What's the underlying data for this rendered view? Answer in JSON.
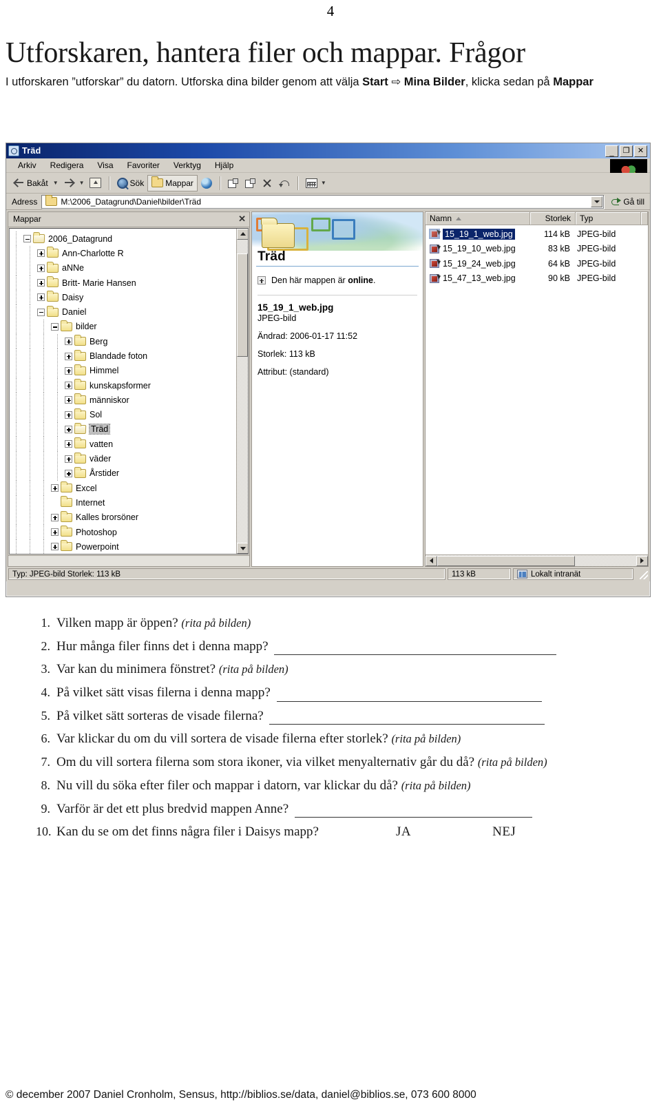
{
  "page": {
    "page_number": "4",
    "title": "Utforskaren, hantera filer och mappar. Frågor",
    "intro_part1": "I utforskaren ”utforskar” du datorn. Utforska dina bilder genom att välja ",
    "intro_bold1": "Start",
    "intro_arrow": " ⇨ ",
    "intro_bold2": "Mina Bilder",
    "intro_part2": ", klicka sedan på ",
    "intro_bold3": "Mappar",
    "footer": "© december 2007 Daniel Cronholm, Sensus, http://biblios.se/data, daniel@biblios.se, 073 600 8000"
  },
  "explorer": {
    "title": "Träd",
    "window_buttons": {
      "minimize": "_",
      "maximize": "❐",
      "close": "✕"
    },
    "menu": [
      "Arkiv",
      "Redigera",
      "Visa",
      "Favoriter",
      "Verktyg",
      "Hjälp"
    ],
    "toolbar": {
      "back": "Bakåt",
      "search": "Sök",
      "folders": "Mappar"
    },
    "address": {
      "label": "Adress",
      "value": "M:\\2006_Datagrund\\Daniel\\bilder\\Träd",
      "go": "Gå till"
    },
    "folders_pane": {
      "header": "Mappar",
      "close": "✕",
      "tree": [
        {
          "label": "2006_Datagrund",
          "depth": 2,
          "toggle": "minus",
          "open": true,
          "selected": false
        },
        {
          "label": "Ann-Charlotte R",
          "depth": 3,
          "toggle": "plus",
          "open": false,
          "selected": false
        },
        {
          "label": "aNNe",
          "depth": 3,
          "toggle": "plus",
          "open": false,
          "selected": false
        },
        {
          "label": "Britt- Marie Hansen",
          "depth": 3,
          "toggle": "plus",
          "open": false,
          "selected": false
        },
        {
          "label": "Daisy",
          "depth": 3,
          "toggle": "plus",
          "open": false,
          "selected": false
        },
        {
          "label": "Daniel",
          "depth": 3,
          "toggle": "minus",
          "open": false,
          "selected": false
        },
        {
          "label": "bilder",
          "depth": 4,
          "toggle": "minus",
          "open": false,
          "selected": false
        },
        {
          "label": "Berg",
          "depth": 5,
          "toggle": "plus",
          "open": false,
          "selected": false
        },
        {
          "label": "Blandade foton",
          "depth": 5,
          "toggle": "plus",
          "open": false,
          "selected": false
        },
        {
          "label": "Himmel",
          "depth": 5,
          "toggle": "plus",
          "open": false,
          "selected": false
        },
        {
          "label": "kunskapsformer",
          "depth": 5,
          "toggle": "plus",
          "open": false,
          "selected": false
        },
        {
          "label": "människor",
          "depth": 5,
          "toggle": "plus",
          "open": false,
          "selected": false
        },
        {
          "label": "Sol",
          "depth": 5,
          "toggle": "plus",
          "open": false,
          "selected": false
        },
        {
          "label": "Träd",
          "depth": 5,
          "toggle": "plus",
          "open": true,
          "selected": true
        },
        {
          "label": "vatten",
          "depth": 5,
          "toggle": "plus",
          "open": false,
          "selected": false
        },
        {
          "label": "väder",
          "depth": 5,
          "toggle": "plus",
          "open": false,
          "selected": false
        },
        {
          "label": "Årstider",
          "depth": 5,
          "toggle": "plus",
          "open": false,
          "selected": false
        },
        {
          "label": "Excel",
          "depth": 4,
          "toggle": "plus",
          "open": false,
          "selected": false
        },
        {
          "label": "Internet",
          "depth": 4,
          "toggle": "none",
          "open": false,
          "selected": false
        },
        {
          "label": "Kalles brorsöner",
          "depth": 4,
          "toggle": "plus",
          "open": false,
          "selected": false
        },
        {
          "label": "Photoshop",
          "depth": 4,
          "toggle": "plus",
          "open": false,
          "selected": false
        },
        {
          "label": "Powerpoint",
          "depth": 4,
          "toggle": "plus",
          "open": false,
          "selected": false
        }
      ]
    },
    "details_pane": {
      "banner_title": "Träd",
      "online_text_prefix": "Den här mappen är ",
      "online_text_bold": "online",
      "online_text_suffix": ".",
      "file_name": "15_19_1_web.jpg",
      "file_type": "JPEG-bild",
      "modified": "Ändrad: 2006-01-17 11:52",
      "size": "Storlek: 113 kB",
      "attributes": "Attribut: (standard)"
    },
    "file_list": {
      "columns": [
        "Namn",
        "Storlek",
        "Typ"
      ],
      "sort_column": "Namn",
      "sort_direction": "asc",
      "rows": [
        {
          "name": "15_19_1_web.jpg",
          "size": "114 kB",
          "type": "JPEG-bild",
          "selected": true
        },
        {
          "name": "15_19_10_web.jpg",
          "size": "83 kB",
          "type": "JPEG-bild",
          "selected": false
        },
        {
          "name": "15_19_24_web.jpg",
          "size": "64 kB",
          "type": "JPEG-bild",
          "selected": false
        },
        {
          "name": "15_47_13_web.jpg",
          "size": "90 kB",
          "type": "JPEG-bild",
          "selected": false
        }
      ]
    },
    "status_bar": {
      "info": "Typ: JPEG-bild Storlek: 113 kB",
      "size": "113 kB",
      "zone": "Lokalt intranät"
    }
  },
  "questions": [
    {
      "num": "1.",
      "text": "Vilken mapp är öppen? ",
      "hint": "(rita på bilden)",
      "blank": 0
    },
    {
      "num": "2.",
      "text": "Hur många filer finns det i denna mapp? ",
      "hint": "",
      "blank": 410
    },
    {
      "num": "3.",
      "text": "Var kan du minimera fönstret? ",
      "hint": "(rita på bilden)",
      "blank": 0
    },
    {
      "num": "4.",
      "text": "På vilket sätt visas filerna i denna mapp? ",
      "hint": "",
      "blank": 385
    },
    {
      "num": "5.",
      "text": "På vilket sätt sorteras de visade filerna? ",
      "hint": "",
      "blank": 400
    },
    {
      "num": "6.",
      "text": "Var klickar du om du vill sortera de visade filerna efter storlek? ",
      "hint": "(rita på bilden)",
      "blank": 0
    },
    {
      "num": "7.",
      "text": "Om du vill sortera filerna som stora ikoner, via vilket menyalternativ går du då? ",
      "hint": "(rita på bilden)",
      "blank": 0
    },
    {
      "num": "8.",
      "text": "Nu vill du söka efter filer och mappar i datorn, var klickar du då? ",
      "hint": "(rita på bilden)",
      "blank": 0
    },
    {
      "num": "9.",
      "text": "Varför är det ett plus bredvid mappen Anne? ",
      "hint": "",
      "blank": 345
    },
    {
      "num": "10.",
      "text": "Kan du se om det finns några filer i Daisys mapp?",
      "hint": "",
      "blank": 0,
      "ja": "JA",
      "nej": "NEJ"
    }
  ]
}
